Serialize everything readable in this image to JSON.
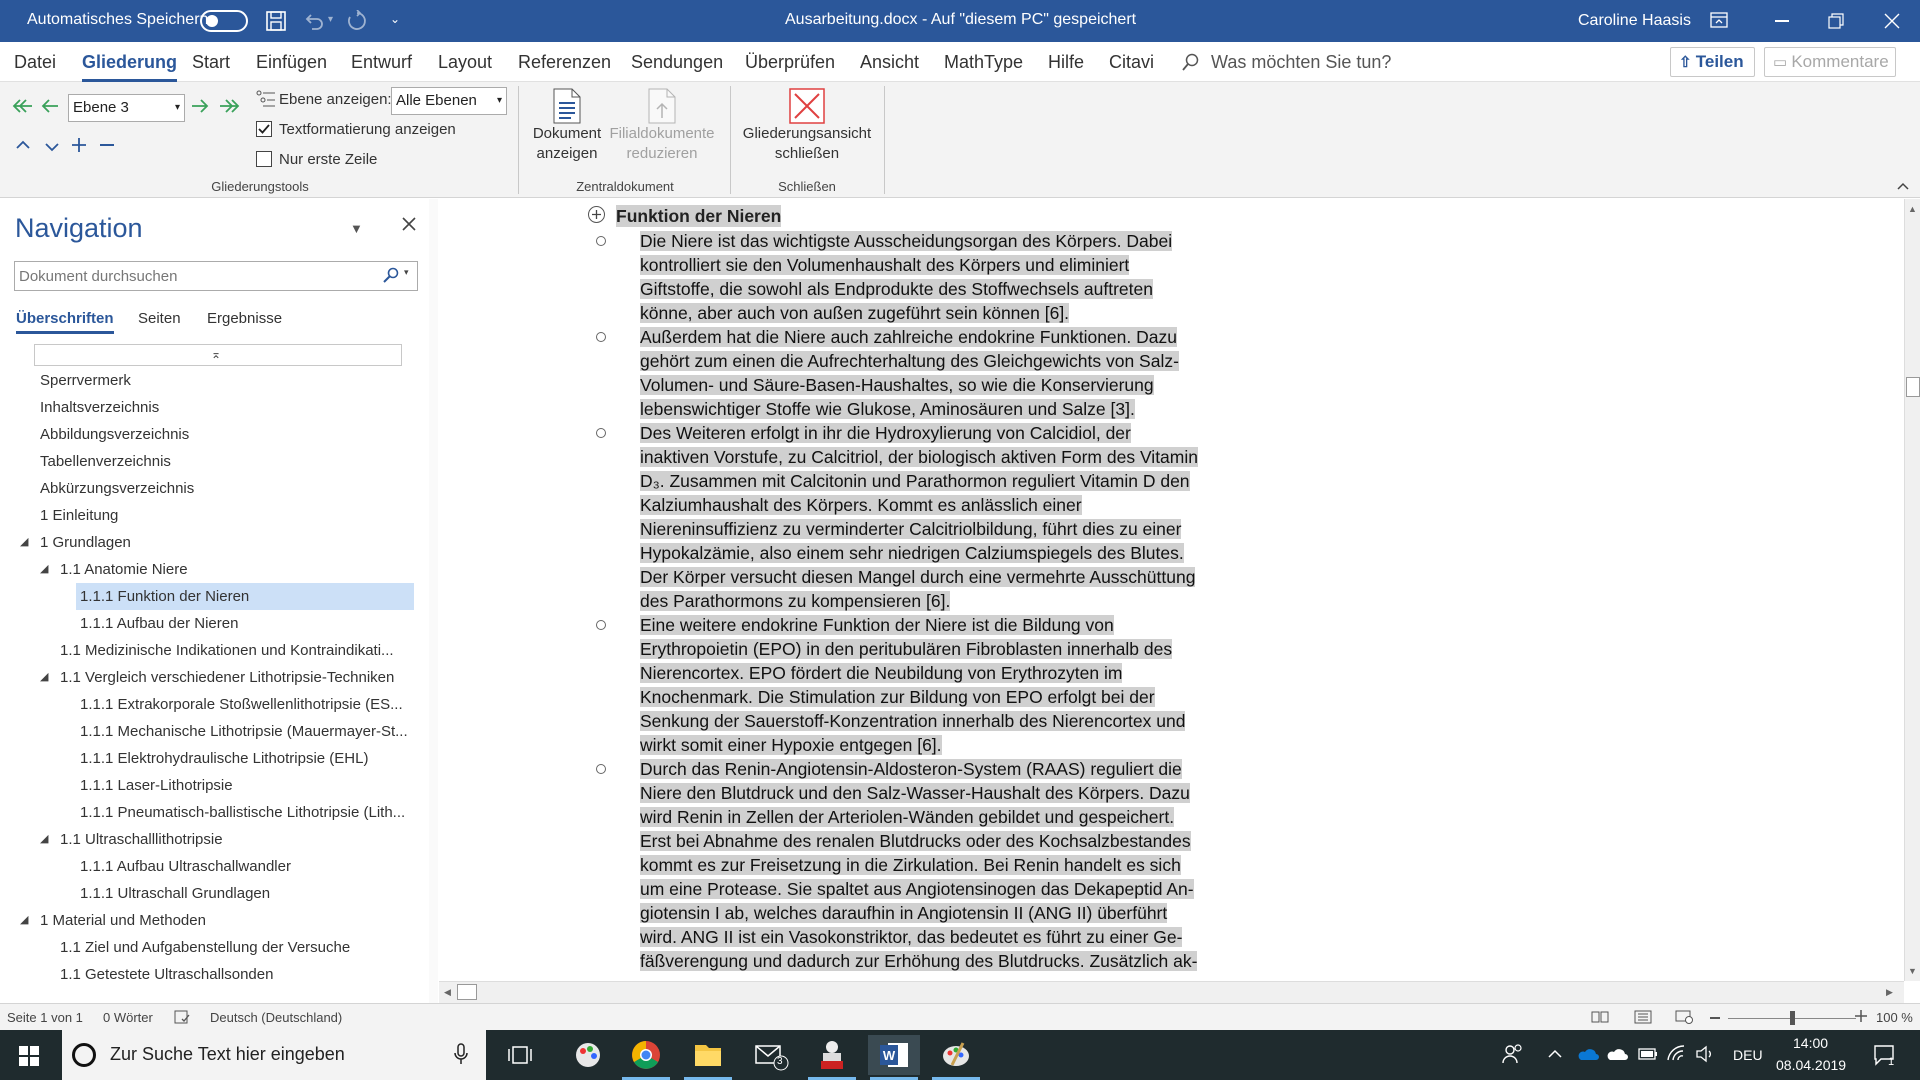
{
  "titlebar": {
    "autosave_label": "Automatisches Speichern",
    "doc_title": "Ausarbeitung.docx  -  Auf \"diesem PC\" gespeichert",
    "user": "Caroline Haasis"
  },
  "menu": {
    "tabs": [
      "Datei",
      "Gliederung",
      "Start",
      "Einfügen",
      "Entwurf",
      "Layout",
      "Referenzen",
      "Sendungen",
      "Überprüfen",
      "Ansicht",
      "MathType",
      "Hilfe",
      "Citavi"
    ],
    "active_tab": "Gliederung",
    "tell_me": "Was möchten Sie tun?",
    "share": "Teilen",
    "comments": "Kommentare"
  },
  "ribbon": {
    "level_value": "Ebene 3",
    "show_level_label": "Ebene anzeigen:",
    "show_level_value": "Alle Ebenen",
    "text_formatting_label": "Textformatierung anzeigen",
    "text_formatting_checked": true,
    "first_line_label": "Nur erste Zeile",
    "first_line_checked": false,
    "show_document_line1": "Dokument",
    "show_document_line2": "anzeigen",
    "collapse_sub_line1": "Filialdokumente",
    "collapse_sub_line2": "reduzieren",
    "close_outline_line1": "Gliederungsansicht",
    "close_outline_line2": "schließen",
    "group_outline_tools": "Gliederungstools",
    "group_master": "Zentraldokument",
    "group_close": "Schließen"
  },
  "navigation": {
    "title": "Navigation",
    "search_placeholder": "Dokument durchsuchen",
    "tabs": [
      "Überschriften",
      "Seiten",
      "Ergebnisse"
    ],
    "active_tab": "Überschriften",
    "headings": [
      {
        "text": "Sperrvermerk",
        "level": 1,
        "expander": false
      },
      {
        "text": "Inhaltsverzeichnis",
        "level": 1,
        "expander": false
      },
      {
        "text": "Abbildungsverzeichnis",
        "level": 1,
        "expander": false
      },
      {
        "text": "Tabellenverzeichnis",
        "level": 1,
        "expander": false
      },
      {
        "text": "Abkürzungsverzeichnis",
        "level": 1,
        "expander": false
      },
      {
        "text": "1 Einleitung",
        "level": 1,
        "expander": false
      },
      {
        "text": "1 Grundlagen",
        "level": 1,
        "expander": true
      },
      {
        "text": "1.1 Anatomie Niere",
        "level": 2,
        "expander": true
      },
      {
        "text": "1.1.1 Funktion der Nieren",
        "level": 3,
        "expander": false,
        "selected": true
      },
      {
        "text": "1.1.1 Aufbau der Nieren",
        "level": 3,
        "expander": false
      },
      {
        "text": "1.1 Medizinische Indikationen und Kontraindikati...",
        "level": 2,
        "expander": false
      },
      {
        "text": "1.1 Vergleich verschiedener Lithotripsie-Techniken",
        "level": 2,
        "expander": true
      },
      {
        "text": "1.1.1 Extrakorporale Stoßwellenlithotripsie (ES...",
        "level": 3,
        "expander": false
      },
      {
        "text": "1.1.1 Mechanische Lithotripsie (Mauermayer-St...",
        "level": 3,
        "expander": false
      },
      {
        "text": "1.1.1 Elektrohydraulische Lithotripsie (EHL)",
        "level": 3,
        "expander": false
      },
      {
        "text": "1.1.1 Laser-Lithotripsie",
        "level": 3,
        "expander": false
      },
      {
        "text": "1.1.1 Pneumatisch-ballistische Lithotripsie (Lith...",
        "level": 3,
        "expander": false
      },
      {
        "text": "1.1 Ultraschalllithotripsie",
        "level": 2,
        "expander": true
      },
      {
        "text": "1.1.1 Aufbau Ultraschallwandler",
        "level": 3,
        "expander": false
      },
      {
        "text": "1.1.1 Ultraschall Grundlagen",
        "level": 3,
        "expander": false
      },
      {
        "text": "1 Material und Methoden",
        "level": 1,
        "expander": true
      },
      {
        "text": "1.1 Ziel und Aufgabenstellung der Versuche",
        "level": 2,
        "expander": false
      },
      {
        "text": "1.1 Getestete Ultraschallsonden",
        "level": 2,
        "expander": false
      }
    ]
  },
  "document": {
    "heading": "Funktion der Nieren",
    "paragraphs": [
      [
        "Die Niere ist das wichtigste Ausscheidungsorgan des Körpers. Dabei",
        "kontrolliert sie den Volumenhaushalt des Körpers und eliminiert",
        "Giftstoffe, die sowohl als Endprodukte des Stoffwechsels auftreten",
        "könne, aber auch von außen zugeführt sein können [6]."
      ],
      [
        "Außerdem hat die Niere auch zahlreiche endokrine Funktionen. Dazu",
        "gehört zum einen die Aufrechterhaltung des Gleichgewichts von Salz-",
        "Volumen- und Säure-Basen-Haushaltes, so wie die Konservierung",
        "lebenswichtiger Stoffe wie Glukose, Aminosäuren und Salze [3]."
      ],
      [
        "Des Weiteren erfolgt in ihr die Hydroxylierung von Calcidiol, der",
        "inaktiven Vorstufe, zu Calcitriol, der biologisch aktiven Form des Vitamin",
        "D₃. Zusammen mit Calcitonin und Parathormon reguliert Vitamin D den",
        "Kalziumhaushalt des Körpers. Kommt es anlässlich einer",
        "Niereninsuffizienz zu verminderter Calcitriolbildung, führt dies zu einer",
        "Hypokalzämie, also einem sehr niedrigen Calziumspiegels des Blutes.",
        "Der Körper versucht diesen Mangel durch eine vermehrte Ausschüttung",
        "des Parathormons zu kompensieren [6]."
      ],
      [
        "Eine weitere endokrine Funktion der Niere ist die Bildung von",
        "Erythropoietin (EPO) in den peritubulären Fibroblasten innerhalb des",
        "Nierencortex. EPO fördert die Neubildung von Erythrozyten im",
        "Knochenmark. Die Stimulation zur Bildung von EPO erfolgt bei der",
        "Senkung der Sauerstoff-Konzentration innerhalb des Nierencortex und",
        "wirkt somit einer Hypoxie entgegen [6]."
      ],
      [
        "Durch das Renin-Angiotensin-Aldosteron-System (RAAS) reguliert die",
        "Niere den Blutdruck und den Salz-Wasser-Haushalt des Körpers. Dazu",
        "wird Renin in Zellen der Arteriolen-Wänden gebildet und gespeichert.",
        "Erst bei Abnahme des renalen Blutdrucks oder des Kochsalzbestandes",
        "kommt es zur Freisetzung in die Zirkulation. Bei Renin handelt es sich",
        "um eine Protease. Sie spaltet aus Angiotensinogen das Dekapeptid An-",
        "giotensin I ab, welches daraufhin in Angiotensin II (ANG II) überführt",
        "wird. ANG II ist ein Vasokonstriktor, das bedeutet es führt zu einer Ge-",
        "fäßverengung und dadurch zur Erhöhung des Blutdrucks. Zusätzlich ak-"
      ]
    ]
  },
  "status": {
    "page": "Seite 1 von 1",
    "words": "0 Wörter",
    "language": "Deutsch (Deutschland)",
    "zoom": "100 %",
    "zoom_fraction": 0.5
  },
  "taskbar": {
    "search_placeholder": "Zur Suche Text hier eingeben",
    "mail_badge": "3",
    "language": "DEU",
    "time": "14:00",
    "date": "08.04.2019",
    "notification_count": "1"
  },
  "colors": {
    "word_blue": "#2b579a",
    "selection_gray": "#d0d0d0",
    "nav_selected": "#cce0f7",
    "close_red": "#e04040",
    "arrow_green": "#3aa15a"
  }
}
